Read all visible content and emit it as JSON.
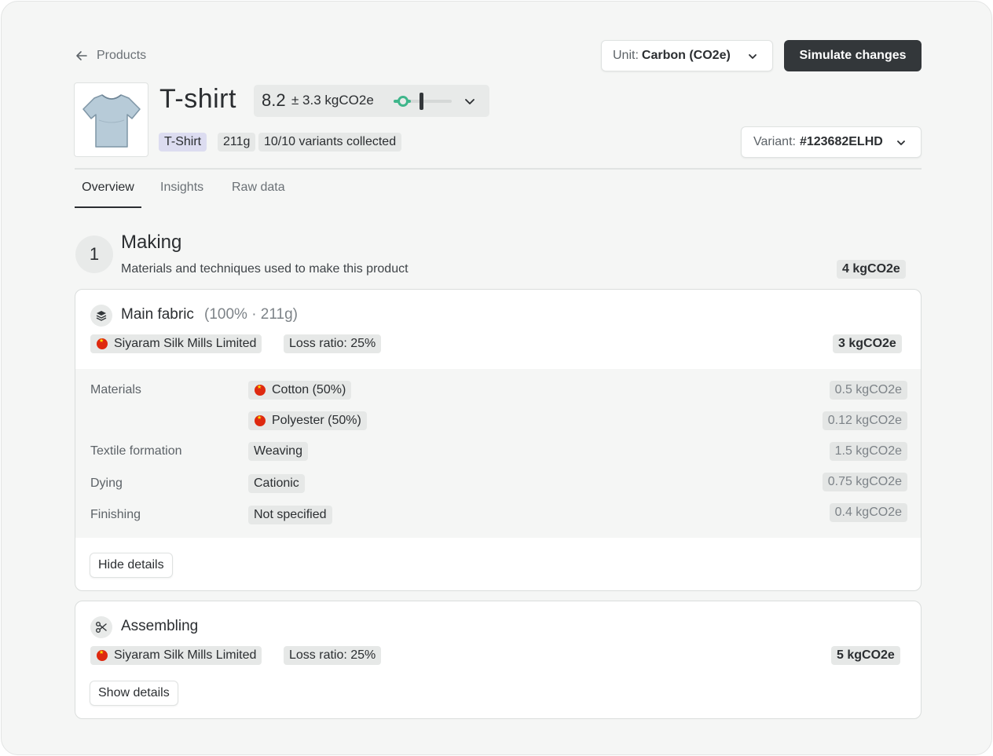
{
  "header": {
    "back_label": "Products",
    "unit_prefix": "Unit:",
    "unit_value": "Carbon (CO2e)",
    "simulate_label": "Simulate changes"
  },
  "product": {
    "title": "T-shirt",
    "co2_value": "8.2",
    "co2_range": "± 3.3 kgCO2e",
    "confidence_level": 0.3,
    "tags": [
      "T-Shirt",
      "211g",
      "10/10 variants collected"
    ],
    "variant_prefix": "Variant:",
    "variant_value": "#123682ELHD"
  },
  "tabs": [
    {
      "label": "Overview",
      "active": true
    },
    {
      "label": "Insights",
      "active": false
    },
    {
      "label": "Raw data",
      "active": false
    }
  ],
  "section": {
    "number": "1",
    "title": "Making",
    "subtitle": "Materials and techniques used to make this product",
    "total": "4 kgCO2e"
  },
  "main_fabric": {
    "title": "Main fabric",
    "meta": "(100% · 211g)",
    "supplier": "Siyaram Silk Mills Limited",
    "loss_ratio": "Loss ratio: 25%",
    "total": "3 kgCO2e",
    "rows": {
      "materials_label": "Materials",
      "cotton": "Cotton (50%)",
      "cotton_value": "0.5 kgCO2e",
      "polyester": "Polyester (50%)",
      "polyester_value": "0.12 kgCO2e",
      "textile_label": "Textile formation",
      "textile": "Weaving",
      "textile_value": "1.5 kgCO2e",
      "dying_label": "Dying",
      "dying": "Cationic",
      "dying_value": "0.75 kgCO2e",
      "finishing_label": "Finishing",
      "finishing": "Not specified",
      "finishing_value": "0.4 kgCO2e"
    },
    "toggle_label": "Hide details"
  },
  "assembling": {
    "title": "Assembling",
    "supplier": "Siyaram Silk Mills Limited",
    "loss_ratio": "Loss ratio: 25%",
    "total": "5 kgCO2e",
    "toggle_label": "Show details"
  },
  "colors": {
    "primary_button": "#33373a",
    "accent_green": "#3fb68b",
    "flag_red": "#de2910"
  }
}
